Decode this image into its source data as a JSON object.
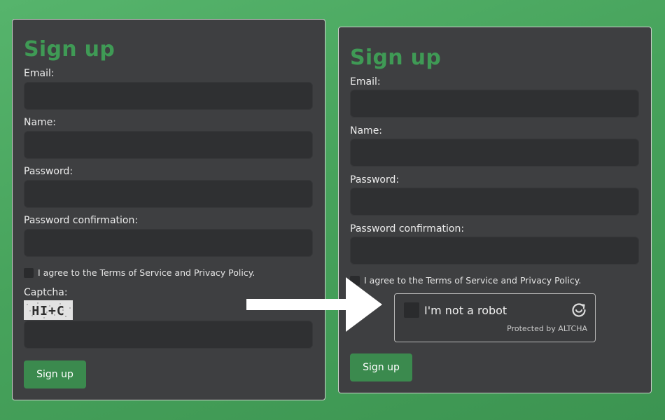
{
  "left_form": {
    "title": "Sign up",
    "email_label": "Email:",
    "name_label": "Name:",
    "password_label": "Password:",
    "password_confirmation_label": "Password confirmation:",
    "email_value": "",
    "name_value": "",
    "password_value": "",
    "password_confirmation_value": "",
    "agree_text": "I agree to the Terms of Service and Privacy Policy.",
    "agree_checked": false,
    "captcha_label": "Captcha:",
    "captcha_image_text": "HI+C",
    "captcha_value": "",
    "submit_label": "Sign up"
  },
  "right_form": {
    "title": "Sign up",
    "email_label": "Email:",
    "name_label": "Name:",
    "password_label": "Password:",
    "password_confirmation_label": "Password confirmation:",
    "email_value": "",
    "name_value": "",
    "password_value": "",
    "password_confirmation_value": "",
    "agree_text": "I agree to the Terms of Service and Privacy Policy.",
    "agree_checked": false,
    "altcha": {
      "checkbox_text": "I'm not a robot",
      "protected_by": "Protected by ALTCHA",
      "icon": "altcha-logo-icon",
      "checked": false
    },
    "submit_label": "Sign up"
  },
  "comparison_arrow": {
    "icon": "right-arrow-icon",
    "color": "#ffffff"
  },
  "colors": {
    "background": "#4caa61",
    "panel": "#3e3f41",
    "field": "#2f3032",
    "title": "#3f9a55",
    "button": "#3b8a4e"
  }
}
